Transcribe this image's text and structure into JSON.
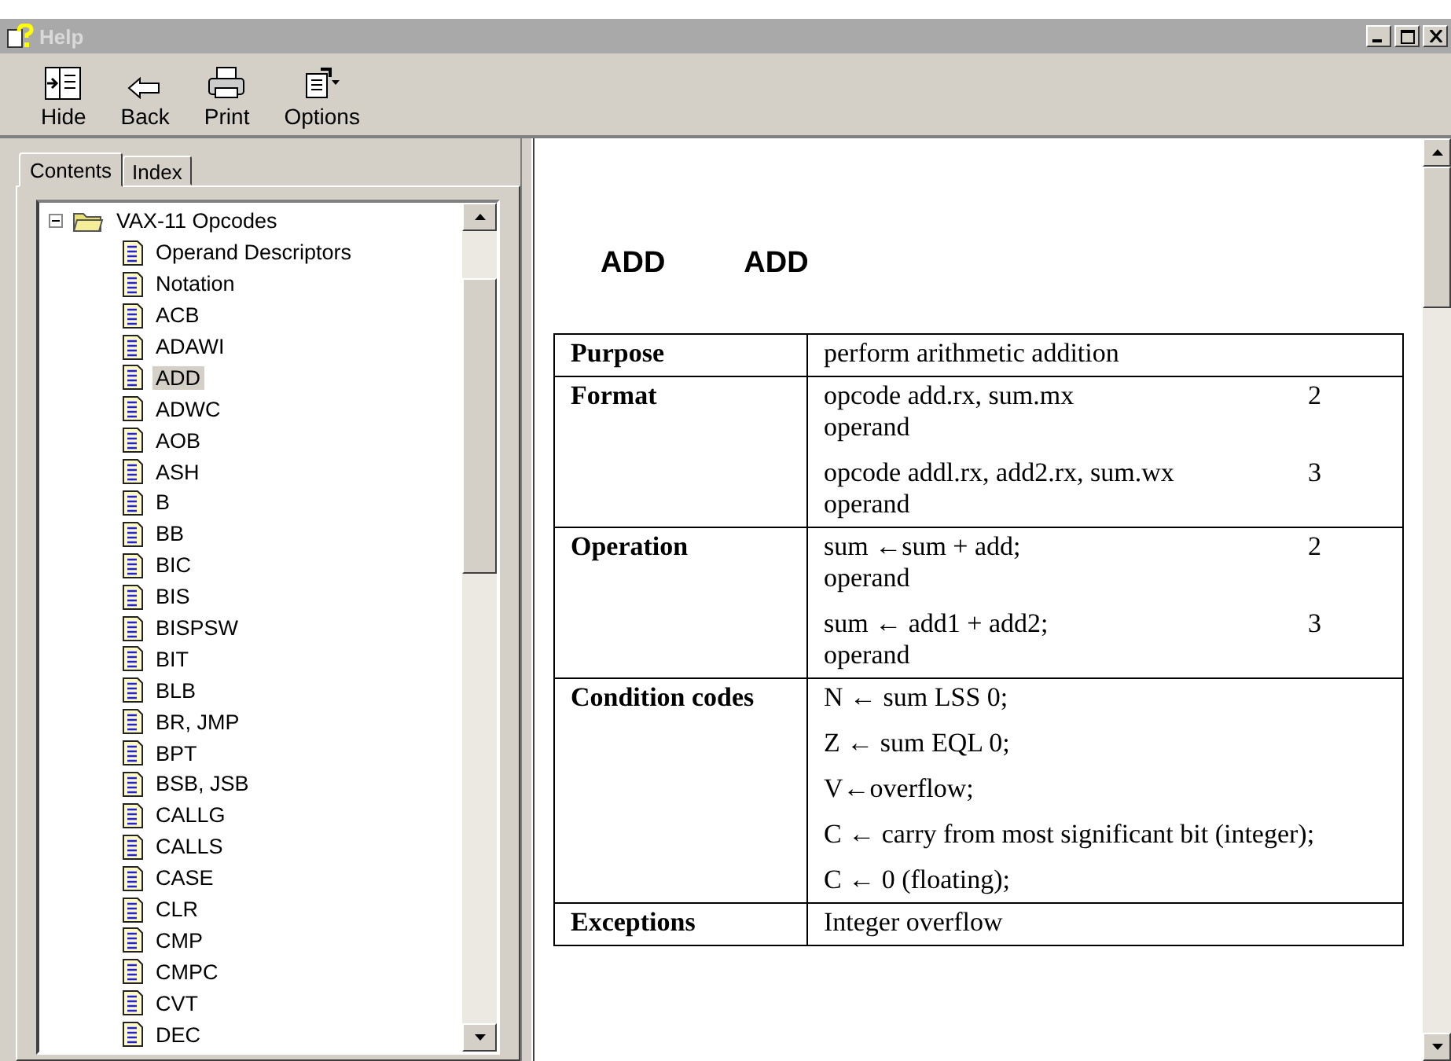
{
  "window": {
    "title": "Help"
  },
  "toolbar": [
    {
      "label": "Hide",
      "kind": "hide"
    },
    {
      "label": "Back",
      "kind": "back"
    },
    {
      "label": "Print",
      "kind": "print"
    },
    {
      "label": "Options",
      "kind": "options"
    }
  ],
  "tabs": [
    {
      "label": "Contents",
      "selected": true
    },
    {
      "label": "Index",
      "selected": false
    }
  ],
  "tree": {
    "label": "VAX-11 Opcodes",
    "expanded": true,
    "children": [
      {
        "label": "Operand Descriptors",
        "selected": false
      },
      {
        "label": "Notation",
        "selected": false
      },
      {
        "label": "ACB",
        "selected": false
      },
      {
        "label": "ADAWI",
        "selected": false
      },
      {
        "label": "ADD",
        "selected": true
      },
      {
        "label": "ADWC",
        "selected": false
      },
      {
        "label": "AOB",
        "selected": false
      },
      {
        "label": "ASH",
        "selected": false
      },
      {
        "label": "B",
        "selected": false
      },
      {
        "label": "BB",
        "selected": false
      },
      {
        "label": "BIC",
        "selected": false
      },
      {
        "label": "BIS",
        "selected": false
      },
      {
        "label": "BISPSW",
        "selected": false
      },
      {
        "label": "BIT",
        "selected": false
      },
      {
        "label": "BLB",
        "selected": false
      },
      {
        "label": "BR, JMP",
        "selected": false
      },
      {
        "label": "BPT",
        "selected": false
      },
      {
        "label": "BSB, JSB",
        "selected": false
      },
      {
        "label": "CALLG",
        "selected": false
      },
      {
        "label": "CALLS",
        "selected": false
      },
      {
        "label": "CASE",
        "selected": false
      },
      {
        "label": "CLR",
        "selected": false
      },
      {
        "label": "CMP",
        "selected": false
      },
      {
        "label": "CMPC",
        "selected": false
      },
      {
        "label": "CVT",
        "selected": false
      },
      {
        "label": "DEC",
        "selected": false
      }
    ]
  },
  "topic": {
    "headings": [
      "ADD",
      "ADD"
    ],
    "rows": [
      {
        "label": "Purpose",
        "entries": [
          {
            "text": "perform arithmetic addition"
          }
        ]
      },
      {
        "label": "Format",
        "entries": [
          {
            "text": "opcode add.rx, sum.mx",
            "count": "2",
            "unit": "operand"
          },
          {
            "text": "opcode addl.rx, add2.rx, sum.wx",
            "count": "3",
            "unit": "operand"
          }
        ]
      },
      {
        "label": "Operation",
        "entries": [
          {
            "text": "sum ←sum + add;",
            "count": "2",
            "unit": "operand"
          },
          {
            "text": "sum ← add1 + add2;",
            "count": "3",
            "unit": "operand"
          }
        ]
      },
      {
        "label": "Condition codes",
        "entries": [
          {
            "text": "N ← sum LSS 0;"
          },
          {
            "text": "Z ← sum EQL 0;"
          },
          {
            "text": "V←overflow;"
          },
          {
            "text": "C ← carry from most significant bit (integer);"
          },
          {
            "text": "C ← 0 (floating);"
          }
        ]
      },
      {
        "label": "Exceptions",
        "entries": [
          {
            "text": "Integer overflow"
          }
        ]
      }
    ]
  }
}
